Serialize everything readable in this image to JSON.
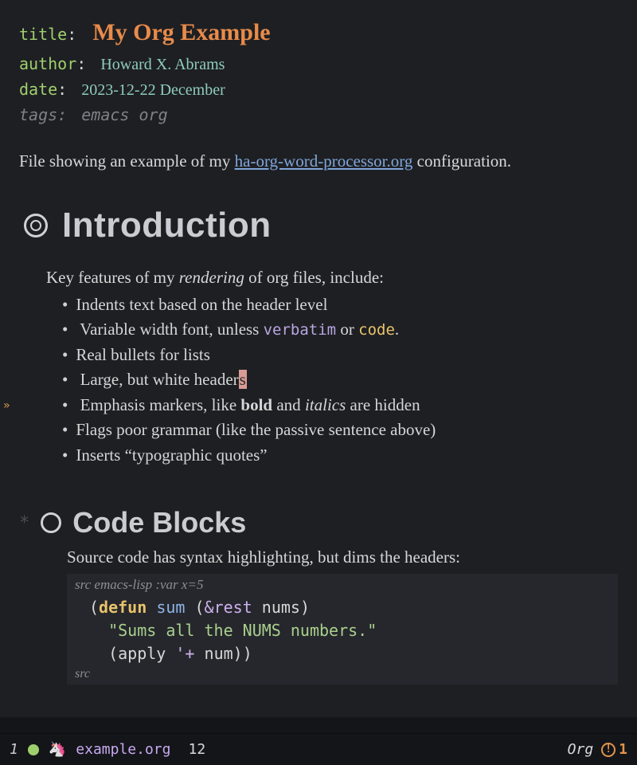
{
  "meta": {
    "title_key": "title",
    "title_val": "My Org Example",
    "author_key": "author",
    "author_val": "Howard X. Abrams",
    "date_key": "date",
    "date_val": "2023-12-22 December",
    "tags_key": "tags",
    "tags_val": "emacs org"
  },
  "intro_para": {
    "before": "File showing an example of my ",
    "link": "ha-org-word-processor.org",
    "after": " configuration."
  },
  "section1": {
    "heading": "Introduction",
    "lead_before": "Key features of my ",
    "lead_em": "rendering",
    "lead_after": " of org files, include:",
    "items": [
      {
        "text": "Indents text based on the header level"
      },
      {
        "before": "Variable width font, unless ",
        "verbatim": "verbatim",
        "mid": " or ",
        "code": "code",
        "after": "."
      },
      {
        "text": "Real bullets for lists"
      },
      {
        "before": "Large, but white header",
        "cursor": "s"
      },
      {
        "before": "Emphasis markers, like ",
        "bold": "bold",
        "mid": " and ",
        "italics": "italics",
        "after": " are hidden"
      },
      {
        "text": "Flags poor grammar (like the passive sentence above)"
      },
      {
        "text": "Inserts “typographic quotes”"
      }
    ]
  },
  "section2": {
    "heading": "Code Blocks",
    "lead": "Source code has syntax highlighting, but dims the headers:",
    "src_header": "src emacs-lisp :var x=5",
    "code": {
      "l1a": "(",
      "l1b": "defun",
      "l1c": " ",
      "l1d": "sum",
      "l1e": " (",
      "l1f": "&rest",
      "l1g": " nums)",
      "l2": "\"Sums all the NUMS numbers.\"",
      "l3a": "(apply ",
      "l3b": "'+",
      "l3c": " num))"
    },
    "src_footer": "src"
  },
  "modeline": {
    "win_num": "1",
    "filename": "example.org",
    "line": "12",
    "major_mode": "Org",
    "warn_count": "1"
  }
}
